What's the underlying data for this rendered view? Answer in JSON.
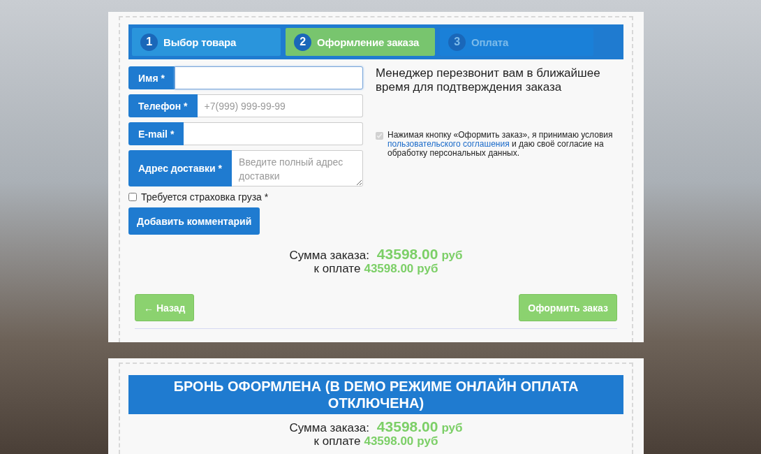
{
  "order_form": {
    "steps": [
      {
        "number": "1",
        "label": "Выбор товара",
        "reached": true,
        "selected": false
      },
      {
        "number": "2",
        "label": "Оформление заказа",
        "reached": true,
        "selected": true
      },
      {
        "number": "3",
        "label": "Оплата",
        "reached": false,
        "selected": false
      }
    ],
    "fields": [
      {
        "label": "Имя *",
        "kind": "input",
        "focused": true
      },
      {
        "label": "Телефон *",
        "kind": "input",
        "placeholder": "+7(999) 999-99-99",
        "focused": false
      },
      {
        "label": "E-mail *",
        "kind": "input",
        "focused": false
      },
      {
        "label": "Адрес доставки *",
        "kind": "textarea",
        "placeholder": "Введите полный адрес доставки",
        "focused": false
      }
    ],
    "insurance": {
      "label": "Требуется страховка груза *",
      "checked": false
    },
    "comment_button": "Добавить комментарий",
    "manager_note": "Менеджер перезвонит вам в ближайшее время для подтверждения заказа",
    "consent": {
      "checked": true,
      "text_before": "Нажимая кнопку «Оформить заказ», я принимаю условия",
      "link": "пользовательского соглашения",
      "text_after": "и даю своё согласие на обработку персональных данных."
    },
    "summary": {
      "total_label": "Сумма заказа:",
      "total_amount": "43598.00",
      "total_currency": "руб",
      "due_label": "к оплате",
      "due_amount": "43598.00",
      "due_currency": "руб"
    },
    "back_button": "← Назад",
    "submit_button": "Оформить заказ"
  },
  "confirmation": {
    "title": "БРОНЬ ОФОРМЛЕНА (В DEMO РЕЖИМЕ ОНЛАЙН ОПЛАТА ОТКЛЮЧЕНА)",
    "summary": {
      "total_label": "Сумма заказа:",
      "total_amount": "43598.00",
      "total_currency": "руб",
      "due_label": "к оплате",
      "due_amount": "43598.00",
      "due_currency": "руб"
    }
  }
}
